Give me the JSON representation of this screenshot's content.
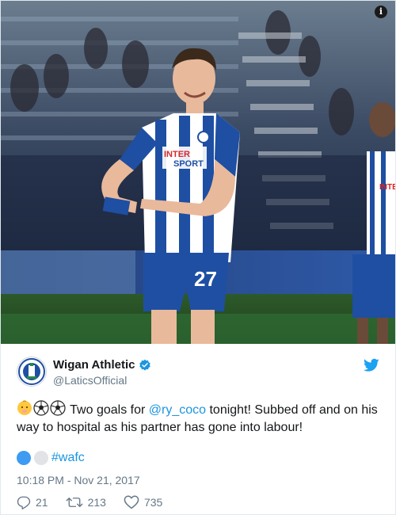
{
  "tweet": {
    "display_name": "Wigan Athletic",
    "handle": "@LaticsOfficial",
    "avatar_icon": "club-crest-icon",
    "verified_icon": "verified-badge-icon",
    "platform_icon": "twitter-bird-icon",
    "info_label": "i",
    "text_before": " Two goals for ",
    "mention": "@ry_coco",
    "text_after": " tonight! Subbed off and on his way to hospital as his partner has gone into labour!",
    "hashtag": "#wafc",
    "timestamp": "10:18 PM - Nov 21, 2017",
    "replies": "21",
    "retweets": "213",
    "likes": "735"
  },
  "photo": {
    "sponsor": "INTER SPORT",
    "shirt_number": "27"
  },
  "colors": {
    "link": "#1b95e0",
    "muted": "#657786",
    "text": "#14171a",
    "kit_blue": "#1e4fa3",
    "dot_blue": "#3d9bf1",
    "dot_grey": "#e1e3e6"
  }
}
